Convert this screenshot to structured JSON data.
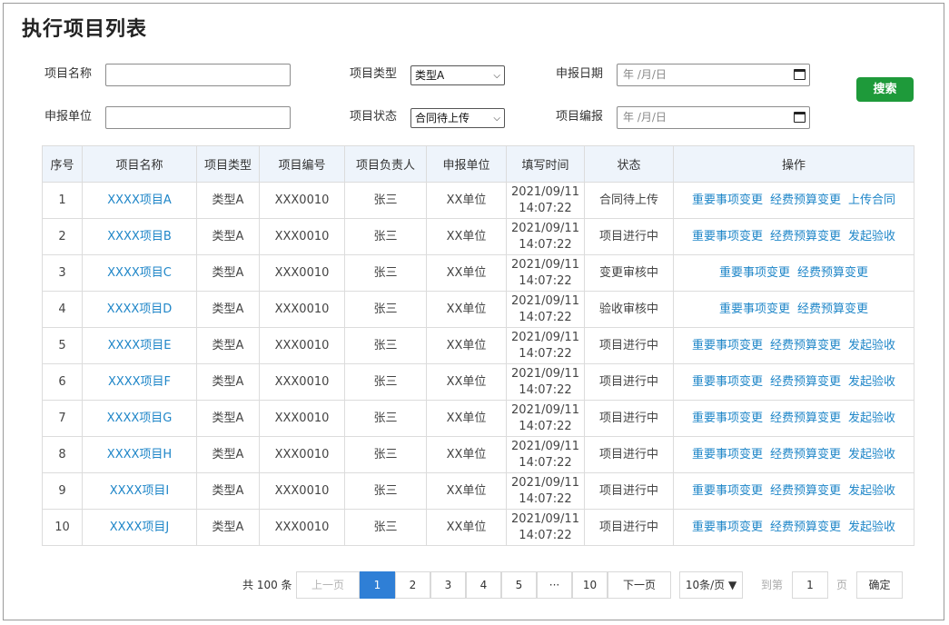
{
  "page": {
    "title": "执行项目列表"
  },
  "filters": {
    "project_name_label": "项目名称",
    "project_name_value": "",
    "project_type_label": "项目类型",
    "project_type_value": "类型A",
    "report_date_label": "申报日期",
    "report_date_placeholder": "年 /月/日",
    "report_unit_label": "申报单位",
    "report_unit_value": "",
    "project_status_label": "项目状态",
    "project_status_value": "合同待上传",
    "project_code_label": "项目编报",
    "project_code_placeholder": "年 /月/日",
    "search_label": "搜索"
  },
  "table": {
    "headers": [
      "序号",
      "项目名称",
      "项目类型",
      "项目编号",
      "项目负责人",
      "申报单位",
      "填写时间",
      "状态",
      "操作"
    ],
    "rows": [
      {
        "no": "1",
        "name": "XXXX项目A",
        "type": "类型A",
        "code": "XXX0010",
        "owner": "张三",
        "unit": "XX单位",
        "date": "2021/09/11",
        "time": "14:07:22",
        "status": "合同待上传",
        "actions": [
          "重要事项变更",
          "经费预算变更",
          "上传合同"
        ]
      },
      {
        "no": "2",
        "name": "XXXX项目B",
        "type": "类型A",
        "code": "XXX0010",
        "owner": "张三",
        "unit": "XX单位",
        "date": "2021/09/11",
        "time": "14:07:22",
        "status": "项目进行中",
        "actions": [
          "重要事项变更",
          "经费预算变更",
          "发起验收"
        ]
      },
      {
        "no": "3",
        "name": "XXXX项目C",
        "type": "类型A",
        "code": "XXX0010",
        "owner": "张三",
        "unit": "XX单位",
        "date": "2021/09/11",
        "time": "14:07:22",
        "status": "变更审核中",
        "actions": [
          "重要事项变更",
          "经费预算变更"
        ]
      },
      {
        "no": "4",
        "name": "XXXX项目D",
        "type": "类型A",
        "code": "XXX0010",
        "owner": "张三",
        "unit": "XX单位",
        "date": "2021/09/11",
        "time": "14:07:22",
        "status": "验收审核中",
        "actions": [
          "重要事项变更",
          "经费预算变更"
        ]
      },
      {
        "no": "5",
        "name": "XXXX项目E",
        "type": "类型A",
        "code": "XXX0010",
        "owner": "张三",
        "unit": "XX单位",
        "date": "2021/09/11",
        "time": "14:07:22",
        "status": "项目进行中",
        "actions": [
          "重要事项变更",
          "经费预算变更",
          "发起验收"
        ]
      },
      {
        "no": "6",
        "name": "XXXX项目F",
        "type": "类型A",
        "code": "XXX0010",
        "owner": "张三",
        "unit": "XX单位",
        "date": "2021/09/11",
        "time": "14:07:22",
        "status": "项目进行中",
        "actions": [
          "重要事项变更",
          "经费预算变更",
          "发起验收"
        ]
      },
      {
        "no": "7",
        "name": "XXXX项目G",
        "type": "类型A",
        "code": "XXX0010",
        "owner": "张三",
        "unit": "XX单位",
        "date": "2021/09/11",
        "time": "14:07:22",
        "status": "项目进行中",
        "actions": [
          "重要事项变更",
          "经费预算变更",
          "发起验收"
        ]
      },
      {
        "no": "8",
        "name": "XXXX项目H",
        "type": "类型A",
        "code": "XXX0010",
        "owner": "张三",
        "unit": "XX单位",
        "date": "2021/09/11",
        "time": "14:07:22",
        "status": "项目进行中",
        "actions": [
          "重要事项变更",
          "经费预算变更",
          "发起验收"
        ]
      },
      {
        "no": "9",
        "name": "XXXX项目I",
        "type": "类型A",
        "code": "XXX0010",
        "owner": "张三",
        "unit": "XX单位",
        "date": "2021/09/11",
        "time": "14:07:22",
        "status": "项目进行中",
        "actions": [
          "重要事项变更",
          "经费预算变更",
          "发起验收"
        ]
      },
      {
        "no": "10",
        "name": "XXXX项目J",
        "type": "类型A",
        "code": "XXX0010",
        "owner": "张三",
        "unit": "XX单位",
        "date": "2021/09/11",
        "time": "14:07:22",
        "status": "项目进行中",
        "actions": [
          "重要事项变更",
          "经费预算变更",
          "发起验收"
        ]
      }
    ]
  },
  "pagination": {
    "total": "共 100 条",
    "prev": "上一页",
    "pages": [
      "1",
      "2",
      "3",
      "4",
      "5",
      "···",
      "10"
    ],
    "current": "1",
    "next": "下一页",
    "page_size": "10条/页 ▼",
    "goto_prefix": "到第",
    "goto_value": "1",
    "goto_suffix": "页",
    "confirm": "确定"
  },
  "colors": {
    "link": "#1f86c8",
    "search_button": "#1e9a3a",
    "active_page": "#2f7fd6",
    "header_bg": "#eef4fb"
  }
}
